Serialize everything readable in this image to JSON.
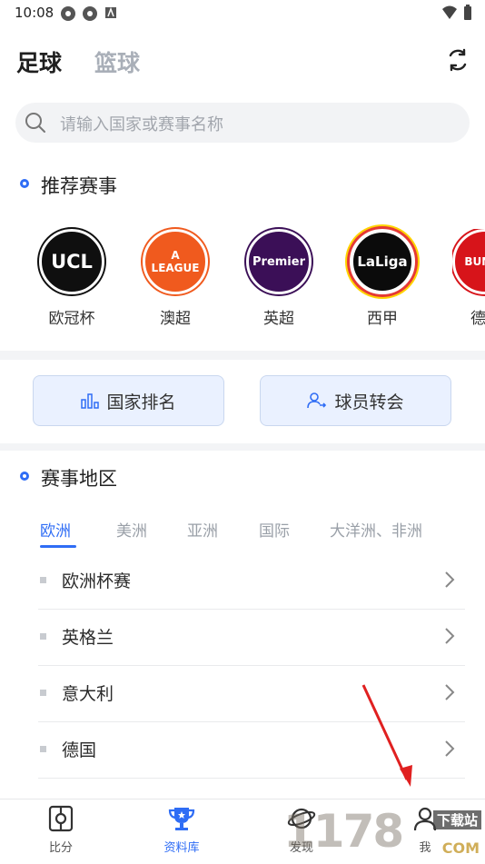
{
  "status_bar": {
    "time": "10:08"
  },
  "header": {
    "tab_football": "足球",
    "tab_basketball": "篮球"
  },
  "search": {
    "placeholder": "请输入国家或赛事名称"
  },
  "recommended": {
    "title": "推荐赛事",
    "leagues": [
      {
        "name": "欧冠杯",
        "logo_text": "UCL",
        "color": "#111111"
      },
      {
        "name": "澳超",
        "logo_text": "A LEAGUE",
        "color": "#f05a1e"
      },
      {
        "name": "英超",
        "logo_text": "Premier",
        "color": "#3b0f57"
      },
      {
        "name": "西甲",
        "logo_text": "LaLiga",
        "color": "#0b0b0b"
      },
      {
        "name": "德",
        "logo_text": "BUN LI",
        "color": "#d7141a"
      }
    ]
  },
  "buttons": {
    "country_rank": "国家排名",
    "transfers": "球员转会"
  },
  "regions": {
    "title": "赛事地区",
    "tabs": [
      "欧洲",
      "美洲",
      "亚洲",
      "国际",
      "大洋洲、非洲"
    ],
    "active_tab": "欧洲",
    "items": [
      "欧洲杯赛",
      "英格兰",
      "意大利",
      "德国"
    ]
  },
  "bottom_nav": [
    "比分",
    "资料库",
    "发现",
    "我"
  ],
  "watermark": {
    "text_main": "1178",
    "text_small": "下载站",
    "text_domain": "COM"
  },
  "colors": {
    "accent": "#2f6df5",
    "button_bg": "#eaf1ff"
  }
}
